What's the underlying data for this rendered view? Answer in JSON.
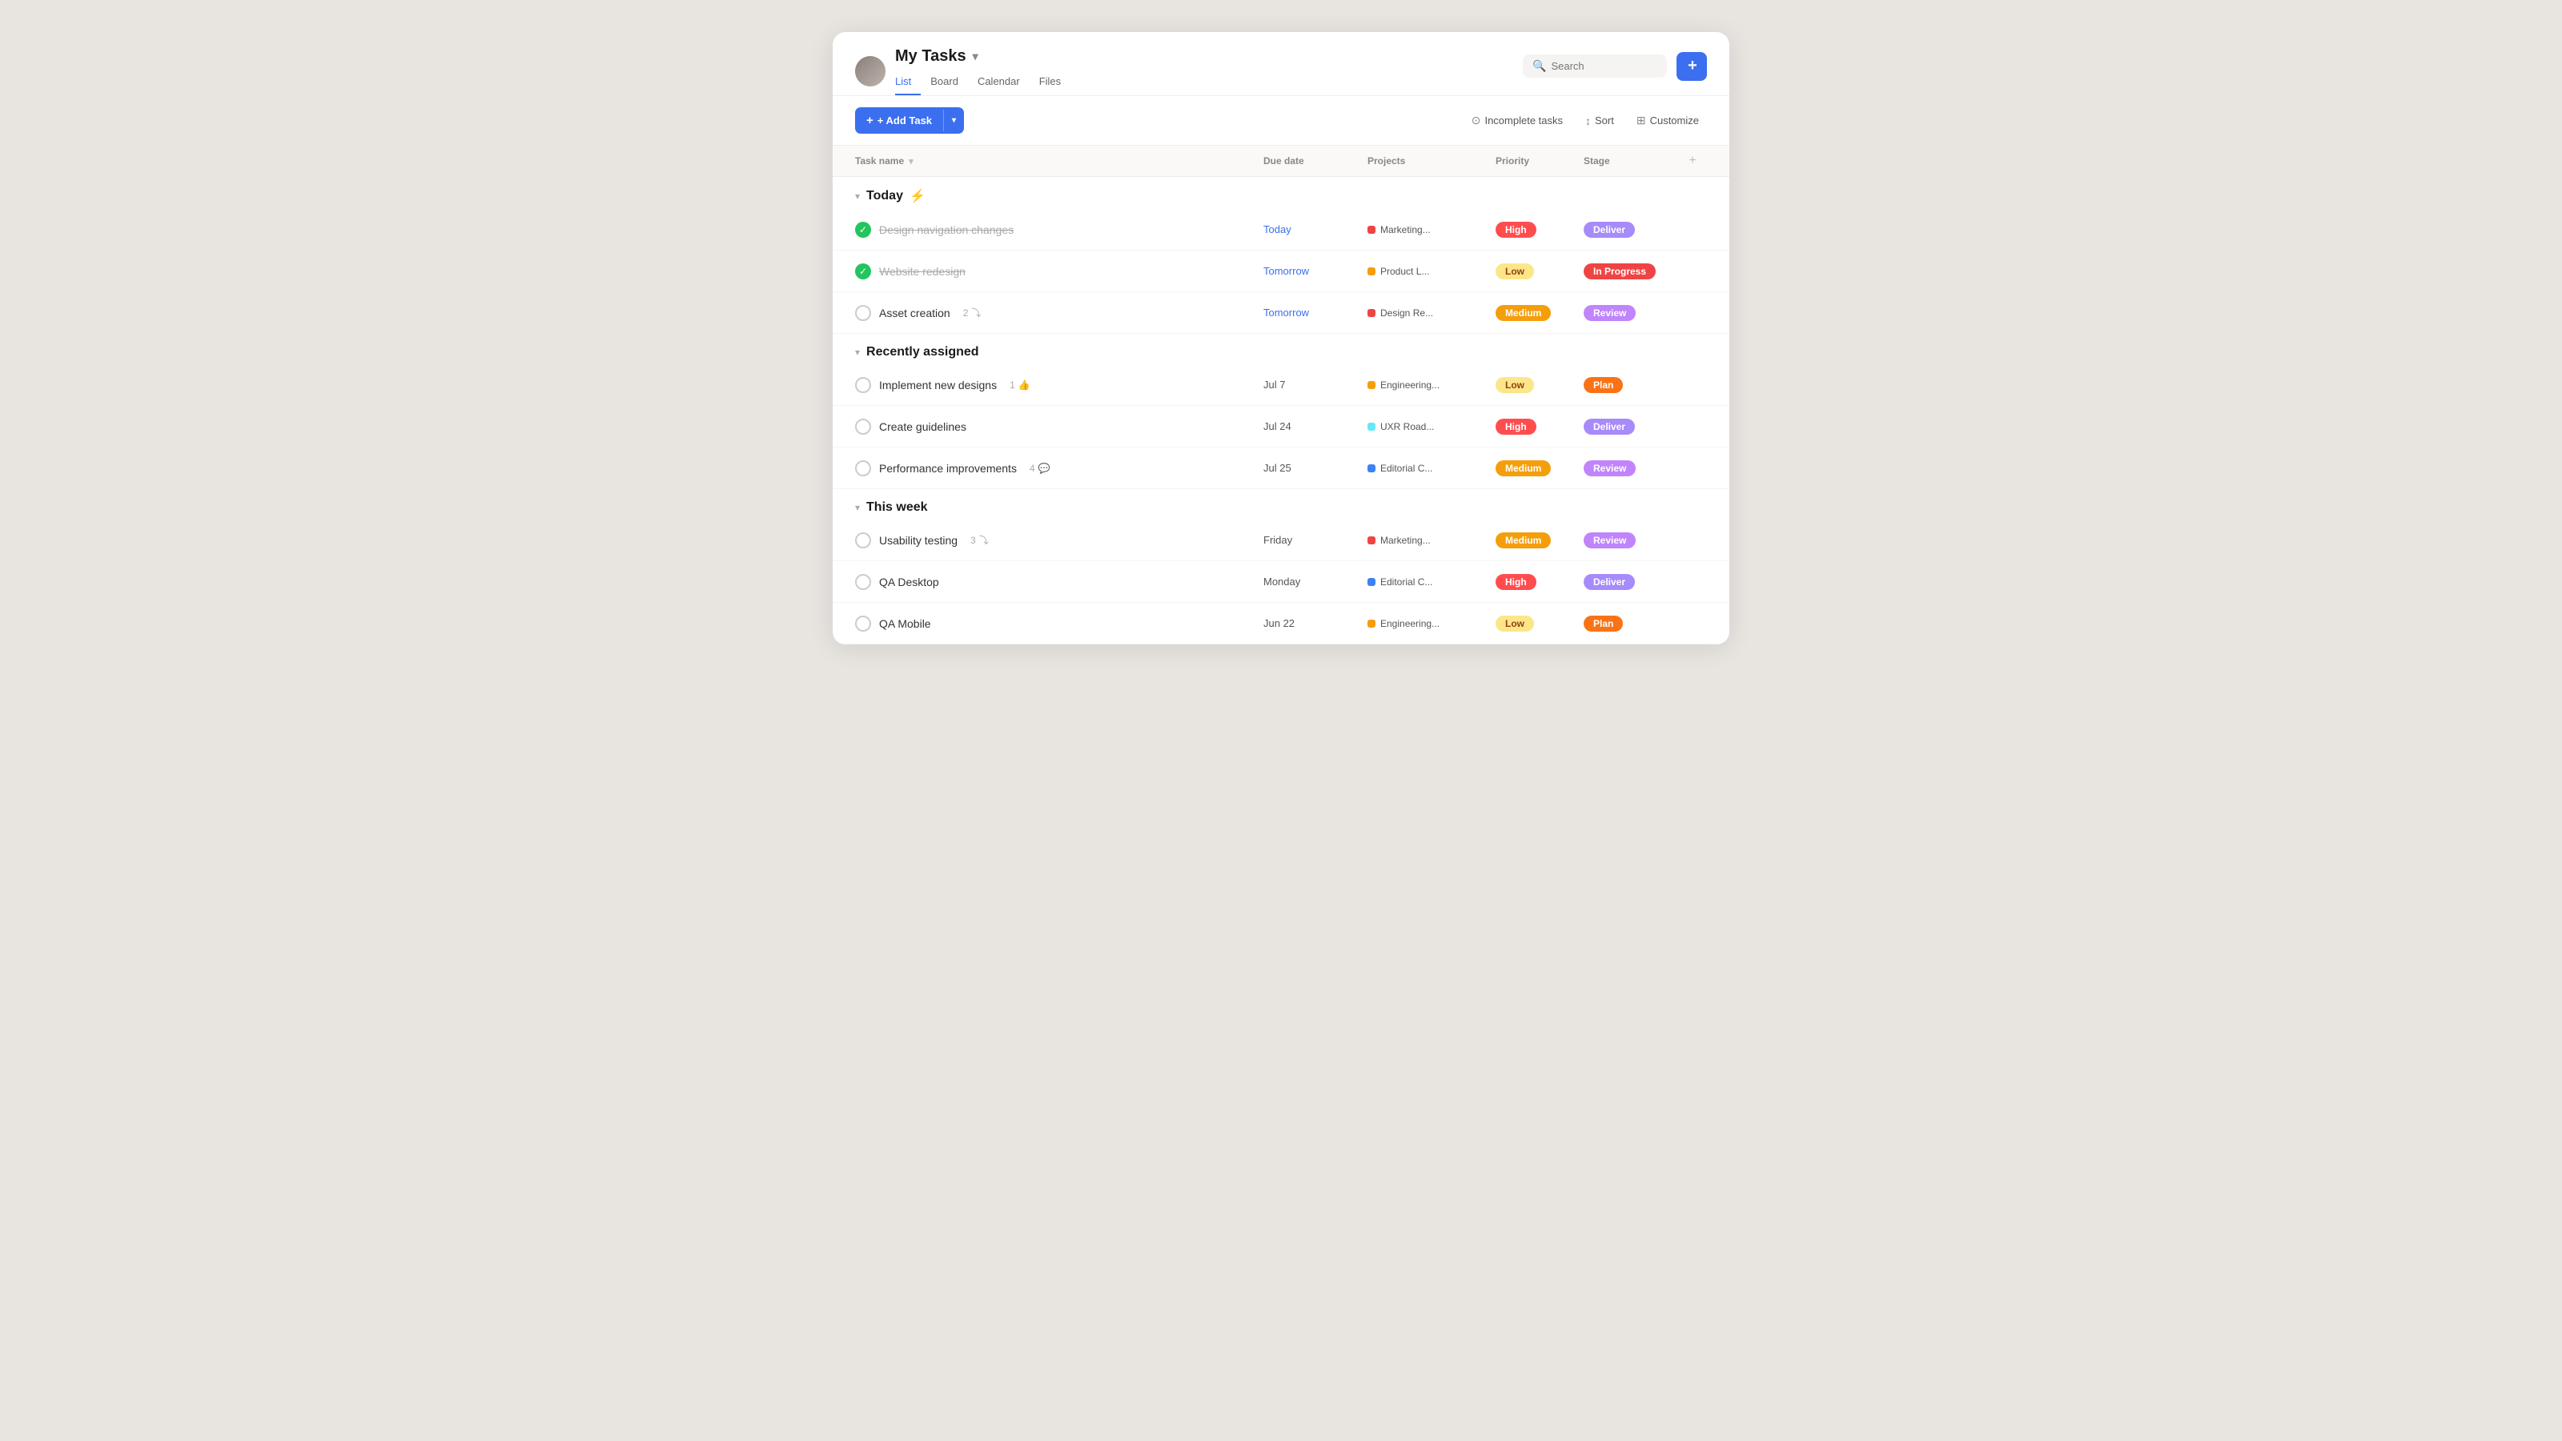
{
  "header": {
    "title": "My Tasks",
    "avatar_alt": "User avatar",
    "tabs": [
      {
        "label": "List",
        "active": true
      },
      {
        "label": "Board",
        "active": false
      },
      {
        "label": "Calendar",
        "active": false
      },
      {
        "label": "Files",
        "active": false
      }
    ],
    "search_placeholder": "Search",
    "add_button_label": "+ Add Task"
  },
  "toolbar": {
    "add_task_label": "+ Add Task",
    "incomplete_tasks_label": "Incomplete tasks",
    "sort_label": "Sort",
    "customize_label": "Customize"
  },
  "table": {
    "columns": {
      "task_name": "Task name",
      "due_date": "Due date",
      "projects": "Projects",
      "priority": "Priority",
      "stage": "Stage"
    }
  },
  "sections": [
    {
      "title": "Today",
      "icon": "⚡",
      "tasks": [
        {
          "name": "Design navigation changes",
          "done": true,
          "due": "Today",
          "due_class": "due-today",
          "project": "Marketing...",
          "project_color": "#ef4444",
          "priority": "High",
          "priority_class": "priority-high",
          "stage": "Deliver",
          "stage_class": "stage-deliver",
          "badges": ""
        },
        {
          "name": "Website redesign",
          "done": true,
          "due": "Tomorrow",
          "due_class": "due-tomorrow",
          "project": "Product L...",
          "project_color": "#f59e0b",
          "priority": "Low",
          "priority_class": "priority-low",
          "stage": "In Progress",
          "stage_class": "stage-inprogress",
          "badges": ""
        },
        {
          "name": "Asset creation",
          "done": false,
          "due": "Tomorrow",
          "due_class": "due-tomorrow",
          "project": "Design Re...",
          "project_color": "#ef4444",
          "priority": "Medium",
          "priority_class": "priority-medium",
          "stage": "Review",
          "stage_class": "stage-review",
          "badges": "2 subtasks",
          "badge_icon": "⤵"
        }
      ]
    },
    {
      "title": "Recently assigned",
      "icon": "",
      "tasks": [
        {
          "name": "Implement new designs",
          "done": false,
          "due": "Jul 7",
          "due_class": "due-date",
          "project": "Engineering...",
          "project_color": "#f59e0b",
          "priority": "Low",
          "priority_class": "priority-low",
          "stage": "Plan",
          "stage_class": "stage-plan",
          "badges": "1 👍",
          "badge_icon": "👍"
        },
        {
          "name": "Create guidelines",
          "done": false,
          "due": "Jul 24",
          "due_class": "due-date",
          "project": "UXR Road...",
          "project_color": "#67e8f9",
          "priority": "High",
          "priority_class": "priority-high",
          "stage": "Deliver",
          "stage_class": "stage-deliver",
          "badges": ""
        },
        {
          "name": "Performance improvements",
          "done": false,
          "due": "Jul 25",
          "due_class": "due-date",
          "project": "Editorial C...",
          "project_color": "#3b82f6",
          "priority": "Medium",
          "priority_class": "priority-medium",
          "stage": "Review",
          "stage_class": "stage-review",
          "badges": "4 💬",
          "badge_icon": "💬"
        }
      ]
    },
    {
      "title": "This week",
      "icon": "",
      "tasks": [
        {
          "name": "Usability testing",
          "done": false,
          "due": "Friday",
          "due_class": "due-date",
          "project": "Marketing...",
          "project_color": "#ef4444",
          "priority": "Medium",
          "priority_class": "priority-medium",
          "stage": "Review",
          "stage_class": "stage-review",
          "badges": "3 subtasks",
          "badge_icon": "⤵"
        },
        {
          "name": "QA Desktop",
          "done": false,
          "due": "Monday",
          "due_class": "due-date",
          "project": "Editorial C...",
          "project_color": "#3b82f6",
          "priority": "High",
          "priority_class": "priority-high",
          "stage": "Deliver",
          "stage_class": "stage-deliver",
          "badges": ""
        },
        {
          "name": "QA Mobile",
          "done": false,
          "due": "Jun 22",
          "due_class": "due-date",
          "project": "Engineering...",
          "project_color": "#f59e0b",
          "priority": "Low",
          "priority_class": "priority-low",
          "stage": "Plan",
          "stage_class": "stage-plan",
          "badges": ""
        }
      ]
    }
  ]
}
